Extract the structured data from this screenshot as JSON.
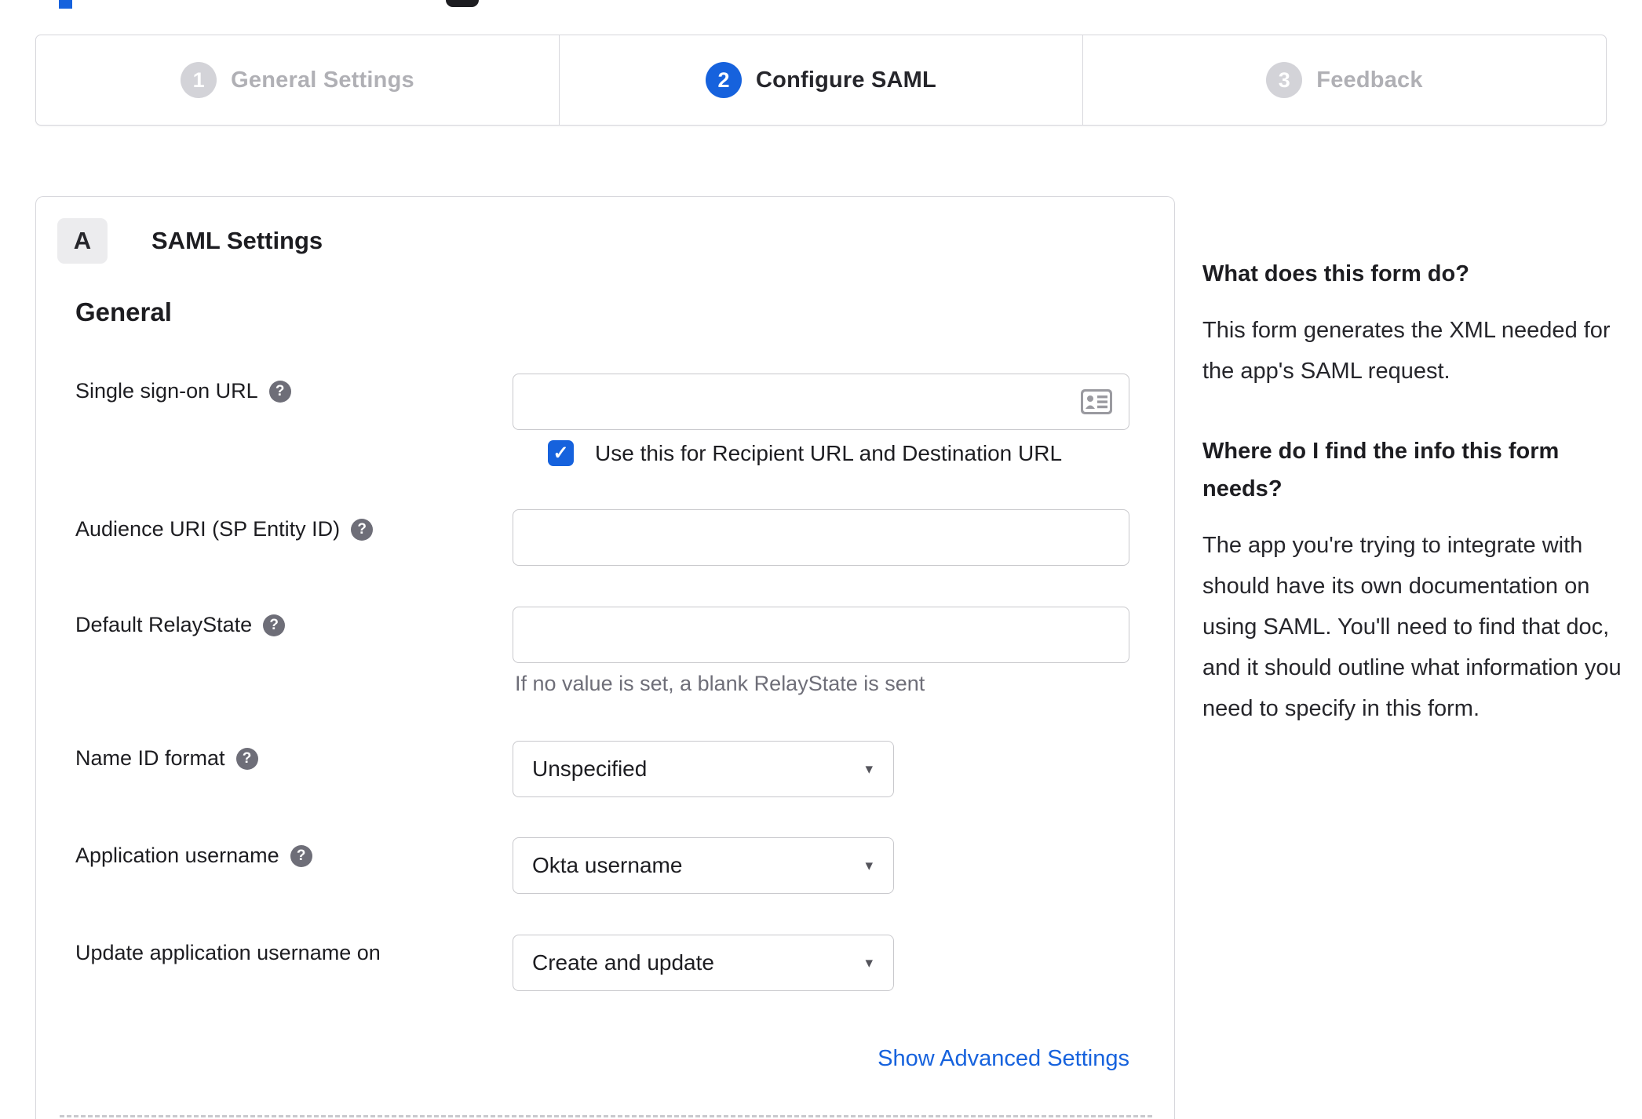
{
  "colors": {
    "accent_blue": "#1662dd",
    "border_gray": "#d7d7dc",
    "inactive_gray": "#b0b0b5",
    "help_gray": "#6e6e78"
  },
  "icons": {
    "help": "?",
    "check": "✓",
    "dropdown_arrow": "▾",
    "contact_card": "contact-card"
  },
  "stepper": {
    "steps": [
      {
        "number": "1",
        "label": "General Settings",
        "state": "inactive"
      },
      {
        "number": "2",
        "label": "Configure SAML",
        "state": "active"
      },
      {
        "number": "3",
        "label": "Feedback",
        "state": "inactive"
      }
    ]
  },
  "panel": {
    "section_badge": "A",
    "section_title": "SAML Settings",
    "group_heading": "General",
    "fields": [
      {
        "label": "Single sign-on URL",
        "type": "text",
        "value": "",
        "checkbox_label": "Use this for Recipient URL and Destination URL",
        "checkbox_checked": true
      },
      {
        "label": "Audience URI (SP Entity ID)",
        "type": "text",
        "value": ""
      },
      {
        "label": "Default RelayState",
        "type": "text",
        "value": "",
        "hint": "If no value is set, a blank RelayState is sent"
      },
      {
        "label": "Name ID format",
        "type": "select",
        "value": "Unspecified"
      },
      {
        "label": "Application username",
        "type": "select",
        "value": "Okta username"
      },
      {
        "label": "Update application username on",
        "type": "select",
        "value": "Create and update"
      }
    ],
    "advanced_link": "Show Advanced Settings"
  },
  "sidebar": {
    "blocks": [
      {
        "heading": "What does this form do?",
        "body": "This form generates the XML needed for the app's SAML request."
      },
      {
        "heading": "Where do I find the info this form needs?",
        "body": "The app you're trying to integrate with should have its own documentation on using SAML. You'll need to find that doc, and it should outline what information you need to specify in this form."
      }
    ]
  }
}
